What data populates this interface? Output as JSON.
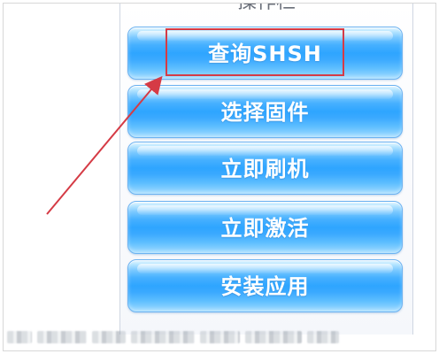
{
  "panel": {
    "title": "操作栏"
  },
  "buttons": [
    {
      "label": "查询SHSH"
    },
    {
      "label": "选择固件"
    },
    {
      "label": "立即刷机"
    },
    {
      "label": "立即激活"
    },
    {
      "label": "安装应用"
    }
  ],
  "annotation": {
    "color": "#d53b45"
  },
  "colors": {
    "button_blue": "#2ea5ff",
    "button_border": "#6bb2f1",
    "button_text": "#ffffff"
  }
}
